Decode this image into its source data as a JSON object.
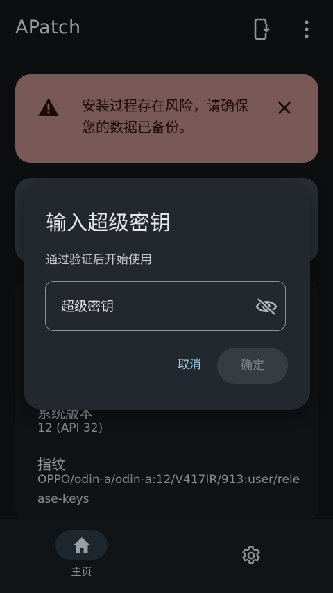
{
  "app": {
    "title": "APatch"
  },
  "warning": {
    "text": "安装过程存在风险，请确保您的数据已备份。"
  },
  "device_info": {
    "system_version_label": "系统版本",
    "system_version_value": "12 (API 32)",
    "fingerprint_label": "指纹",
    "fingerprint_value": "OPPO/odin-a/odin-a:12/V417IR/913:user/release-keys"
  },
  "nav": {
    "home_label": "主页"
  },
  "dialog": {
    "title": "输入超级密钥",
    "description": "通过验证后开始使用",
    "input_placeholder": "超级密钥",
    "cancel_label": "取消",
    "confirm_label": "确定"
  },
  "colors": {
    "background": "#121519",
    "warning_card": "#b28482",
    "accent_text": "#9ccaf0",
    "dialog": "#23282e"
  },
  "icons": {
    "install": "install-mobile-icon",
    "more": "more-vert-icon",
    "warning": "warning-triangle-icon",
    "close": "close-icon",
    "visibility": "visibility-off-icon",
    "home": "home-icon",
    "settings": "gear-icon"
  }
}
